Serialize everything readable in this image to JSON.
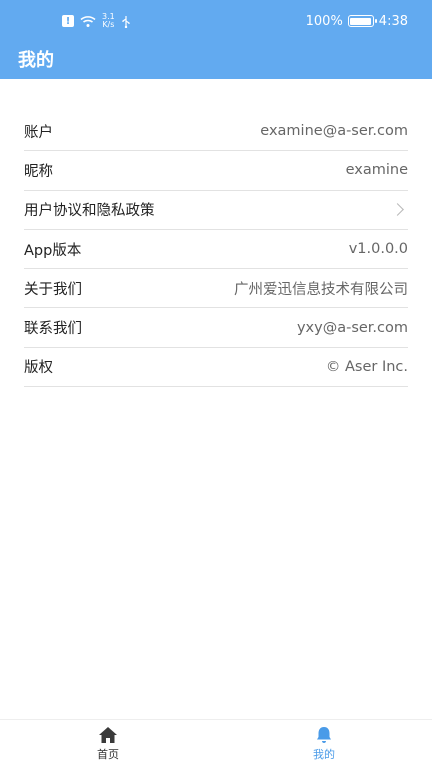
{
  "status_bar": {
    "net_speed_value": "3.1",
    "net_speed_unit": "K/s",
    "battery_percent": "100%",
    "battery_level": 1.0,
    "time": "4:38"
  },
  "header": {
    "title": "我的"
  },
  "rows": [
    {
      "label": "账户",
      "value": "examine@a-ser.com"
    },
    {
      "label": "昵称",
      "value": "examine"
    },
    {
      "label": "用户协议和隐私政策",
      "value": ""
    },
    {
      "label": "App版本",
      "value": "v1.0.0.0"
    },
    {
      "label": "关于我们",
      "value": "广州爱迅信息技术有限公司"
    },
    {
      "label": "联系我们",
      "value": "yxy@a-ser.com"
    },
    {
      "label": "版权",
      "value": "© Aser Inc."
    }
  ],
  "tabs": [
    {
      "label": "首页",
      "icon": "home-icon",
      "active": false
    },
    {
      "label": "我的",
      "icon": "bell-icon",
      "active": true
    }
  ],
  "colors": {
    "accent": "#62aaf0",
    "tab_active": "#4a9be8"
  }
}
